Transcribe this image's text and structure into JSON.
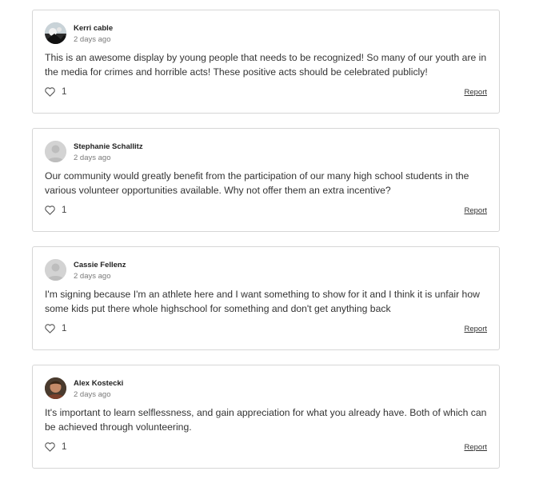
{
  "comments": [
    {
      "author": "Kerri cable",
      "time": "2 days ago",
      "text": "This is an awesome display by young people that needs to be recognized! So many of our youth are in the media for crimes and horrible acts! These positive acts should be celebrated publicly!",
      "likes": "1",
      "report_label": "Report",
      "avatar": "photo"
    },
    {
      "author": "Stephanie Schallitz",
      "time": "2 days ago",
      "text": "Our community would greatly benefit from the participation of our many high school students in the various volunteer opportunities available. Why not offer them an extra incentive?",
      "likes": "1",
      "report_label": "Report",
      "avatar": "default"
    },
    {
      "author": "Cassie Fellenz",
      "time": "2 days ago",
      "text": "I'm signing because I'm an athlete here and I want something to show for it and I think it is unfair how some kids put there whole highschool for something and don't get anything back",
      "likes": "1",
      "report_label": "Report",
      "avatar": "default"
    },
    {
      "author": "Alex Kostecki",
      "time": "2 days ago",
      "text": "It's important to learn selflessness, and gain appreciation for what you already have. Both of which can be achieved through volunteering.",
      "likes": "1",
      "report_label": "Report",
      "avatar": "photo"
    }
  ],
  "colors": {
    "border": "#d6d6d6",
    "default_avatar": "#d3d3d3",
    "text": "#333333",
    "muted": "#7a7a7a"
  },
  "icons": {
    "like": "heart-icon",
    "default_avatar": "user-silhouette-icon"
  }
}
